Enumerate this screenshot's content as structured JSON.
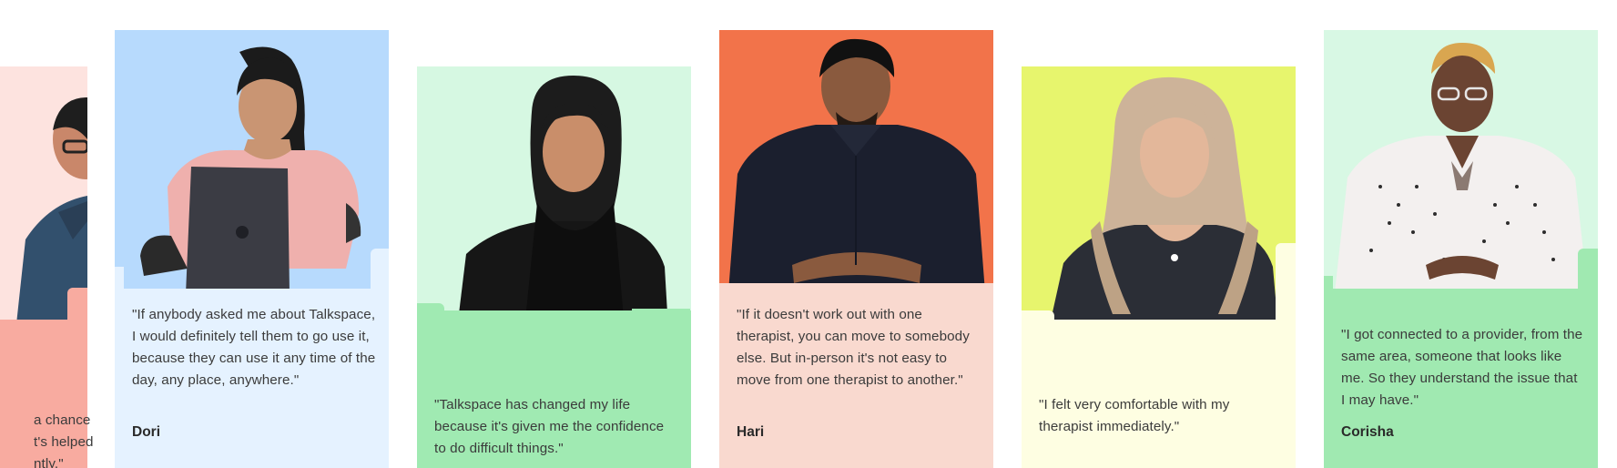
{
  "testimonials": [
    {
      "quote_fragment_lines": [
        "a chance",
        "t's helped",
        "ntly.\""
      ],
      "name": "",
      "photo_color": "#fde3df",
      "panel_color": "#f8aba0"
    },
    {
      "quote": "\"If anybody asked me about Talkspace, I would definitely tell them to go use it, because they can use it any time of the day, any place, anywhere.\"",
      "name": "Dori",
      "photo_color": "#b7dafd",
      "panel_color": "#e5f2ff"
    },
    {
      "quote": "\"Talkspace has changed my life because it's given me the confidence to do difficult things.\"",
      "name": "",
      "photo_color": "#d6f8e2",
      "panel_color": "#a0eab2"
    },
    {
      "quote": "\"If it doesn't work out with one therapist, you can move to somebody else. But in-person it's not easy to move from one therapist to another.\"",
      "name": "Hari",
      "photo_color": "#f2734a",
      "panel_color": "#f9d9cf"
    },
    {
      "quote": "\"I felt very comfortable with my therapist immediately.\"",
      "name": "",
      "photo_color": "#e7f56d",
      "panel_color": "#fefee2"
    },
    {
      "quote": "\"I got connected to a provider, from the same area, someone that looks like me. So they understand the issue that I may have.\"",
      "name": "Corisha",
      "photo_color": "#d8f8e4",
      "panel_color": "#a0e9b1"
    }
  ]
}
